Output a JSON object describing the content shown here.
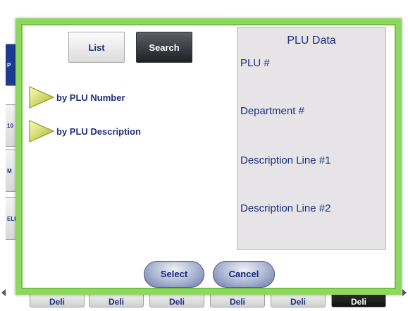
{
  "background": {
    "side_tabs": [
      "P",
      "10",
      "M",
      "ELE"
    ],
    "bottom_buttons": [
      "Deli",
      "Deli",
      "Deli",
      "Deli",
      "Deli",
      "Deli"
    ]
  },
  "dialog": {
    "toggle": {
      "list_label": "List",
      "search_label": "Search",
      "selected": "Search"
    },
    "options": [
      {
        "label": "by PLU Number"
      },
      {
        "label": "by PLU Description"
      }
    ],
    "plu_data": {
      "title": "PLU Data",
      "fields": [
        "PLU #",
        "Department #",
        "Description Line #1",
        "Description Line #2"
      ]
    },
    "select_label": "Select",
    "cancel_label": "Cancel"
  },
  "colors": {
    "frame": "#8fd860",
    "text_blue": "#1c2f80",
    "panel": "#e6e4e7"
  }
}
